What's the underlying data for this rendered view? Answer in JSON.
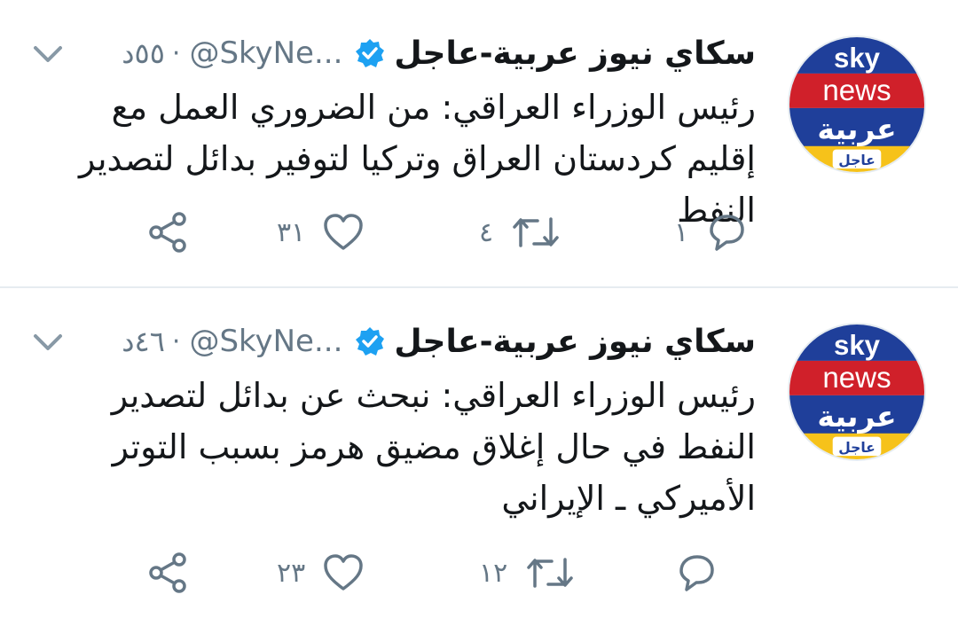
{
  "tweets": [
    {
      "name": "سكاي نيوز عربية-عاجل",
      "handle": "@SkyNe...",
      "dot": "·",
      "time": "٥٥د",
      "text": "رئيس الوزراء العراقي: من الضروري العمل مع إقليم كردستان العراق وتركيا لتوفير بدائل لتصدير النفط",
      "replies": "١",
      "retweets": "٤",
      "likes": "٣١",
      "avatar": {
        "line1": "sky",
        "line2": "news",
        "line3": "عربية",
        "badge": "عاجل"
      }
    },
    {
      "name": "سكاي نيوز عربية-عاجل",
      "handle": "@SkyNe...",
      "dot": "·",
      "time": "٤٦د",
      "text": "رئيس الوزراء العراقي: نبحث عن بدائل لتصدير النفط في حال إغلاق مضيق هرمز بسبب التوتر الأميركي ـ الإيراني",
      "replies": "",
      "retweets": "١٢",
      "likes": "٢٣",
      "avatar": {
        "line1": "sky",
        "line2": "news",
        "line3": "عربية",
        "badge": "عاجل"
      }
    }
  ],
  "colors": {
    "text": "#14171a",
    "secondary": "#657786",
    "verified": "#1da1f2",
    "logo_blue": "#1f3f9a",
    "logo_red": "#d0202a",
    "logo_yellow": "#f6c21a"
  },
  "icons": [
    "chevron-down-icon",
    "verified-badge-icon",
    "reply-icon",
    "retweet-icon",
    "like-icon",
    "share-icon"
  ]
}
